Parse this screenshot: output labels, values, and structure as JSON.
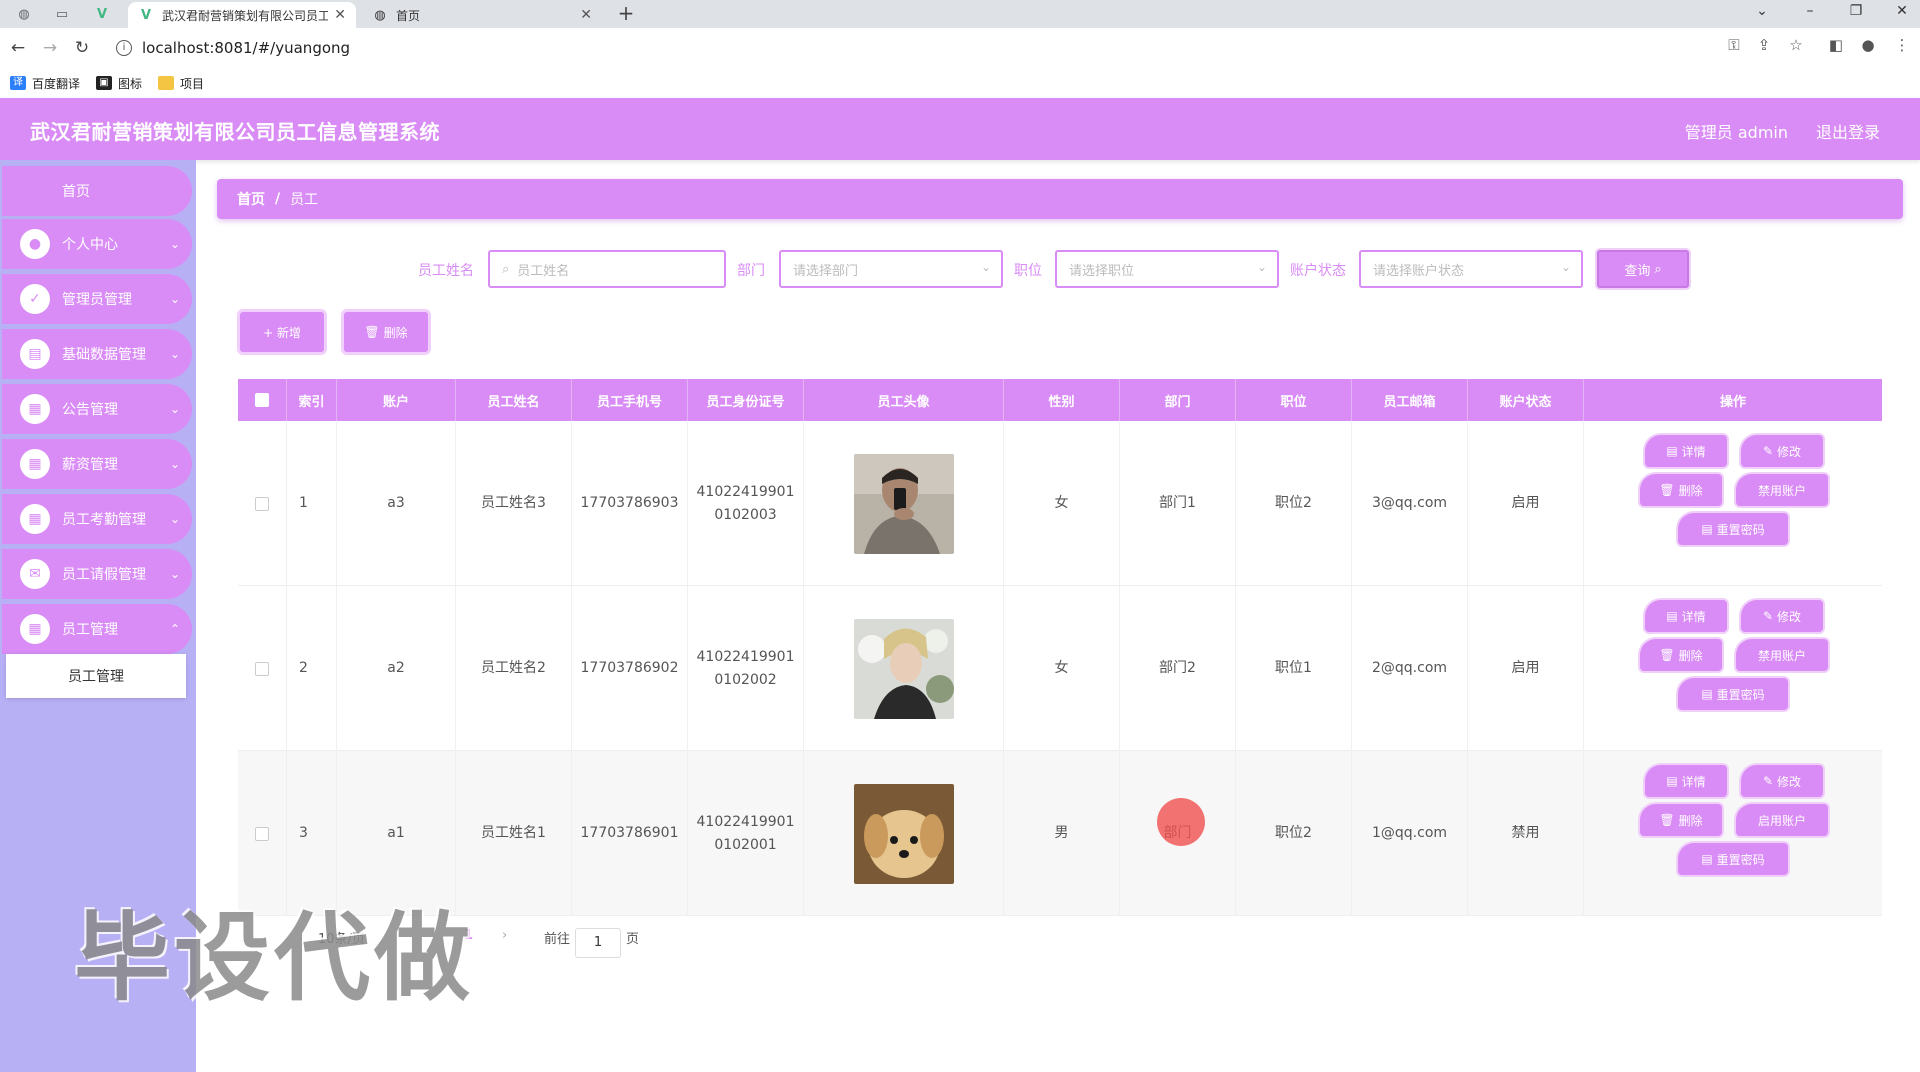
{
  "browser": {
    "tabs": [
      {
        "title": "武汉君耐营销策划有限公司员工信"
      },
      {
        "title": "首页"
      }
    ],
    "url": "localhost:8081/#/yuangong",
    "bookmarks": [
      "百度翻译",
      "图标",
      "项目"
    ]
  },
  "header": {
    "title": "武汉君耐营销策划有限公司员工信息管理系统",
    "user": "管理员 admin",
    "logout": "退出登录"
  },
  "sidebar": {
    "home": "首页",
    "items": [
      {
        "label": "个人中心",
        "icon": "user-icon"
      },
      {
        "label": "管理员管理",
        "icon": "admin-icon"
      },
      {
        "label": "基础数据管理",
        "icon": "clipboard-icon"
      },
      {
        "label": "公告管理",
        "icon": "grid-icon"
      },
      {
        "label": "薪资管理",
        "icon": "grid-icon"
      },
      {
        "label": "员工考勤管理",
        "icon": "grid-icon"
      },
      {
        "label": "员工请假管理",
        "icon": "chat-icon"
      },
      {
        "label": "员工管理",
        "icon": "grid-icon"
      }
    ],
    "submenu": "员工管理"
  },
  "breadcrumb": {
    "home": "首页",
    "separator": "/",
    "current": "员工"
  },
  "search": {
    "name_label": "员工姓名",
    "name_placeholder": "员工姓名",
    "dept_label": "部门",
    "dept_placeholder": "请选择部门",
    "pos_label": "职位",
    "pos_placeholder": "请选择职位",
    "status_label": "账户状态",
    "status_placeholder": "请选择账户状态",
    "query_button": "查询"
  },
  "actions": {
    "add": "+ 新增",
    "delete": "删除"
  },
  "table": {
    "headers": [
      "索引",
      "账户",
      "员工姓名",
      "员工手机号",
      "员工身份证号",
      "员工头像",
      "性别",
      "部门",
      "职位",
      "员工邮箱",
      "账户状态",
      "操作"
    ],
    "rows": [
      {
        "index": "1",
        "account": "a3",
        "name": "员工姓名3",
        "phone": "17703786903",
        "id_line1": "41022419901",
        "id_line2": "0102003",
        "gender": "女",
        "dept": "部门1",
        "position": "职位2",
        "email": "3@qq.com",
        "status": "启用",
        "toggle": "禁用账户"
      },
      {
        "index": "2",
        "account": "a2",
        "name": "员工姓名2",
        "phone": "17703786902",
        "id_line1": "41022419901",
        "id_line2": "0102002",
        "gender": "女",
        "dept": "部门2",
        "position": "职位1",
        "email": "2@qq.com",
        "status": "启用",
        "toggle": "禁用账户"
      },
      {
        "index": "3",
        "account": "a1",
        "name": "员工姓名1",
        "phone": "17703786901",
        "id_line1": "41022419901",
        "id_line2": "0102001",
        "gender": "男",
        "dept": "部门",
        "position": "职位2",
        "email": "1@qq.com",
        "status": "禁用",
        "toggle": "启用账户"
      }
    ],
    "op_detail": "详情",
    "op_edit": "修改",
    "op_delete": "删除",
    "op_reset": "重置密码"
  },
  "pagination": {
    "per_page": "10条/页",
    "current_page": "1",
    "goto": "前往",
    "page_value": "1",
    "page_unit": "页"
  },
  "watermark": "毕设代做",
  "colors": {
    "primary": "#d98cf5",
    "sidebar": "#b8b0f5"
  }
}
